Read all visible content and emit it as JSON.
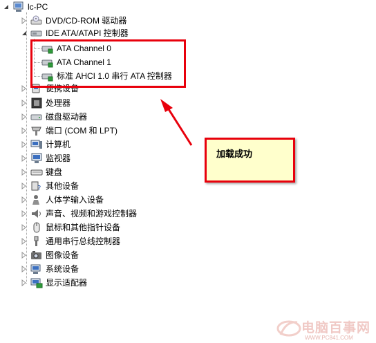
{
  "tree": {
    "root": "lc-PC",
    "items": [
      {
        "label": "DVD/CD-ROM 驱动器",
        "icon": "dvd-drive-icon"
      },
      {
        "label": "IDE ATA/ATAPI 控制器",
        "icon": "ide-controller-icon",
        "children": [
          "ATA Channel 0",
          "ATA Channel 1",
          "标准 AHCI 1.0 串行 ATA 控制器"
        ]
      },
      {
        "label": "便携设备",
        "icon": "portable-device-icon"
      },
      {
        "label": "处理器",
        "icon": "processor-icon"
      },
      {
        "label": "磁盘驱动器",
        "icon": "disk-drive-icon"
      },
      {
        "label": "端口 (COM 和 LPT)",
        "icon": "port-icon"
      },
      {
        "label": "计算机",
        "icon": "computer-icon"
      },
      {
        "label": "监视器",
        "icon": "monitor-icon"
      },
      {
        "label": "键盘",
        "icon": "keyboard-icon"
      },
      {
        "label": "其他设备",
        "icon": "other-devices-icon"
      },
      {
        "label": "人体学输入设备",
        "icon": "hid-icon"
      },
      {
        "label": "声音、视频和游戏控制器",
        "icon": "sound-icon"
      },
      {
        "label": "鼠标和其他指针设备",
        "icon": "mouse-icon"
      },
      {
        "label": "通用串行总线控制器",
        "icon": "usb-icon"
      },
      {
        "label": "图像设备",
        "icon": "imaging-icon"
      },
      {
        "label": "系统设备",
        "icon": "system-devices-icon"
      },
      {
        "label": "显示适配器",
        "icon": "display-adapter-icon"
      }
    ]
  },
  "annotation": {
    "callout": "加载成功",
    "color": "#e8000c"
  },
  "watermark": {
    "text": "电脑百事网",
    "url": "WWW.PC841.COM"
  }
}
